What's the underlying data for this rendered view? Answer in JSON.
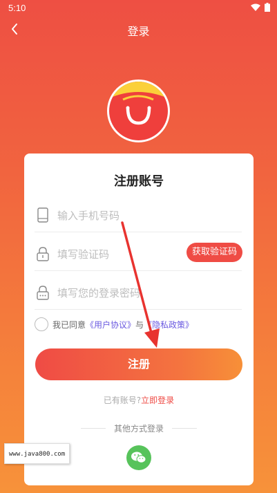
{
  "status_bar": {
    "time": "5:10"
  },
  "nav": {
    "title": "登录"
  },
  "card": {
    "title": "注册账号",
    "phone_placeholder": "输入手机号码",
    "code_placeholder": "填写验证码",
    "code_button": "获取验证码",
    "password_placeholder": "填写您的登录密码",
    "agree_prefix": "我已同意",
    "user_agreement": "《用户协议》",
    "agree_and": "与",
    "privacy_policy": "《隐私政策》",
    "register_button": "注册",
    "has_account": "已有账号?",
    "login_now": "立即登录",
    "other_login": "其他方式登录"
  },
  "watermark": {
    "text": "www.java800.com"
  },
  "colors": {
    "accent": "#ef4b45",
    "link": "#6a59e0",
    "wechat": "#57c35b"
  },
  "icons": [
    "back-icon",
    "wifi-icon",
    "battery-icon",
    "shopping-bag-logo",
    "phone-icon",
    "lock-icon",
    "password-lock-icon",
    "wechat-icon"
  ]
}
